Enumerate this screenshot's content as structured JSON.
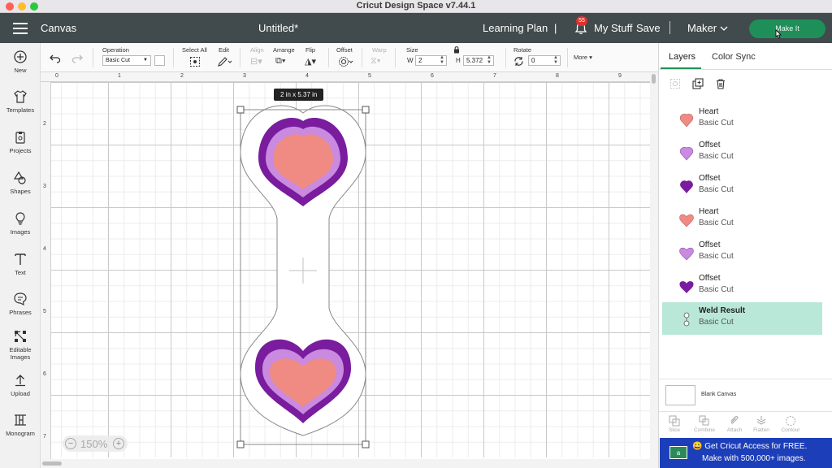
{
  "window": {
    "title": "Cricut Design Space  v7.44.1"
  },
  "header": {
    "section": "Canvas",
    "document_title": "Untitled*",
    "learning_plan": "Learning Plan",
    "separator": "|",
    "notification_count": "55",
    "my_stuff": "My Stuff",
    "save": "Save",
    "machine": "Maker",
    "make_it": "Make It"
  },
  "toolbar": {
    "operation_label": "Operation",
    "operation_value": "Basic Cut",
    "select_all": "Select All",
    "edit": "Edit",
    "align": "Align",
    "arrange": "Arrange",
    "flip": "Flip",
    "offset": "Offset",
    "warp": "Warp",
    "size_label": "Size",
    "w_label": "W",
    "w_value": "2",
    "h_label": "H",
    "h_value": "5.372",
    "rotate_label": "Rotate",
    "rotate_value": "0",
    "more": "More"
  },
  "left_rail": [
    {
      "label": "New",
      "icon": "plus-circle-icon"
    },
    {
      "label": "Templates",
      "icon": "shirt-icon"
    },
    {
      "label": "Projects",
      "icon": "clipboard-icon"
    },
    {
      "label": "Shapes",
      "icon": "shapes-icon"
    },
    {
      "label": "Images",
      "icon": "lightbulb-icon"
    },
    {
      "label": "Text",
      "icon": "text-icon"
    },
    {
      "label": "Phrases",
      "icon": "speech-bubble-icon"
    },
    {
      "label": "Editable Images",
      "icon": "editable-image-icon"
    },
    {
      "label": "Upload",
      "icon": "upload-icon"
    },
    {
      "label": "Monogram",
      "icon": "monogram-icon"
    }
  ],
  "canvas": {
    "ruler_top": [
      "0",
      "1",
      "2",
      "3",
      "4",
      "5",
      "6",
      "7",
      "8",
      "9"
    ],
    "ruler_left": [
      "2",
      "3",
      "4",
      "5",
      "6",
      "7"
    ],
    "size_tooltip": "2  in x 5.37  in",
    "zoom": "150%"
  },
  "right_panel": {
    "tabs": [
      "Layers",
      "Color Sync"
    ],
    "layers": [
      {
        "name": "Heart",
        "operation": "Basic Cut",
        "color": "#f08b84",
        "shape": "teardrop"
      },
      {
        "name": "Offset",
        "operation": "Basic Cut",
        "color": "#c98ae0",
        "shape": "teardrop"
      },
      {
        "name": "Offset",
        "operation": "Basic Cut",
        "color": "#7a1c9e",
        "shape": "teardrop"
      },
      {
        "name": "Heart",
        "operation": "Basic Cut",
        "color": "#f08b84",
        "shape": "heart"
      },
      {
        "name": "Offset",
        "operation": "Basic Cut",
        "color": "#c98ae0",
        "shape": "heart"
      },
      {
        "name": "Offset",
        "operation": "Basic Cut",
        "color": "#7a1c9e",
        "shape": "heart"
      },
      {
        "name": "Weld Result",
        "operation": "Basic Cut",
        "color": "#ffffff",
        "shape": "weld",
        "selected": true
      }
    ],
    "blank_canvas": "Blank Canvas",
    "bottom_tools": [
      "Slice",
      "Combine",
      "Attach",
      "Flatten",
      "Contour"
    ],
    "promo_line1": "Get Cricut Access for FREE.",
    "promo_line2": "Make with 500,000+ images."
  },
  "colors": {
    "header_bg": "#414a4c",
    "accent": "#1f8f5a",
    "selected_row": "#b9e8d9",
    "heart_pink": "#f08b84",
    "offset_light": "#c98ae0",
    "offset_dark": "#7a1c9e",
    "promo_bg": "#1c3eb8"
  }
}
